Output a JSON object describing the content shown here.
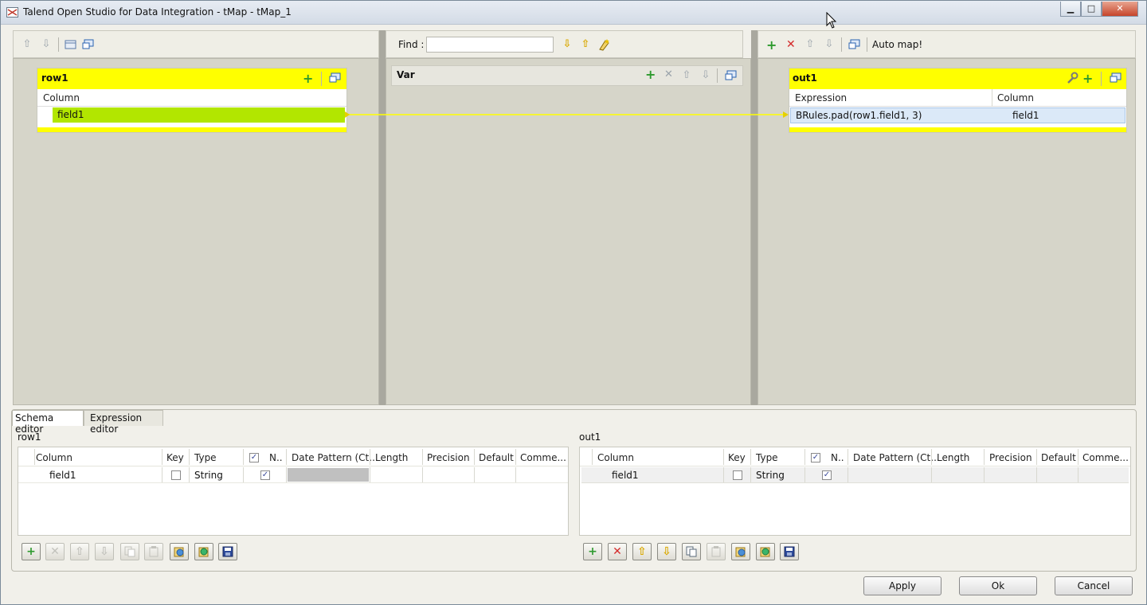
{
  "window": {
    "title": "Talend Open Studio for Data Integration - tMap - tMap_1",
    "min": "▁",
    "max": "□",
    "close": "✕"
  },
  "find": {
    "label": "Find :",
    "value": ""
  },
  "output_toolbar": {
    "auto_map": "Auto map!"
  },
  "input_table": {
    "name": "row1",
    "column_header": "Column",
    "rows": [
      "field1"
    ]
  },
  "var_table": {
    "name": "Var"
  },
  "output_table": {
    "name": "out1",
    "expression_header": "Expression",
    "column_header": "Column",
    "rows": [
      {
        "expression": "BRules.pad(row1.field1, 3)",
        "column": "field1"
      }
    ]
  },
  "tabs": [
    "Schema editor",
    "Expression editor"
  ],
  "schema": {
    "headers": [
      "Column",
      "Key",
      "Type",
      "N..",
      "Date Pattern (Ct...",
      "Length",
      "Precision",
      "Default",
      "Comme..."
    ],
    "left": {
      "name": "row1",
      "rows": [
        {
          "column": "field1",
          "key": false,
          "type": "String",
          "nullable": true
        }
      ]
    },
    "right": {
      "name": "out1",
      "rows": [
        {
          "column": "field1",
          "key": false,
          "type": "String",
          "nullable": true
        }
      ]
    }
  },
  "buttons": {
    "apply": "Apply",
    "ok": "Ok",
    "cancel": "Cancel"
  },
  "icons": {
    "check": "✓",
    "add": "+",
    "remove": "✕",
    "up": "⇧",
    "down": "⇩"
  },
  "colors": {
    "table_header": "#ffff00",
    "selected_input": "#b2e600",
    "link_line": "#ffff00"
  }
}
